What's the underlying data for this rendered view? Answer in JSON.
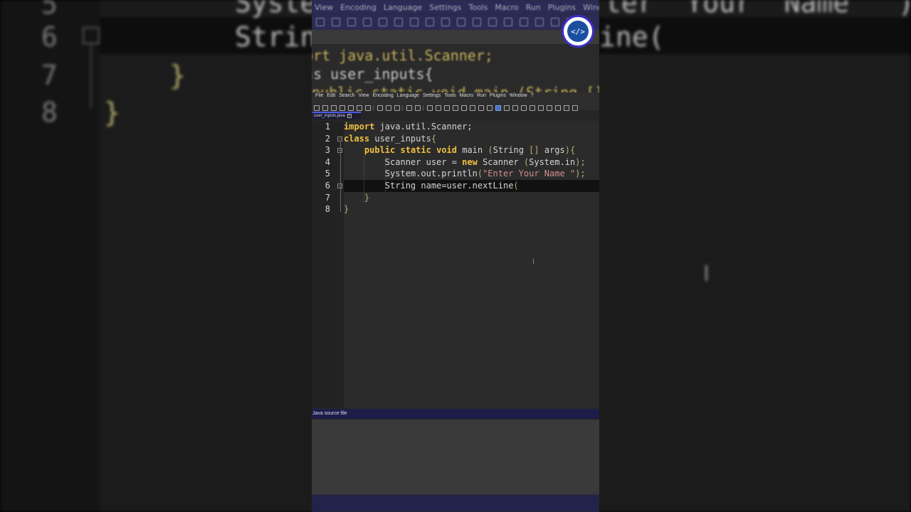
{
  "background": {
    "line_numbers": [
      "5",
      "6",
      "7",
      "8"
    ],
    "code_lines": [
      "Syste",
      "Strin",
      "ter  Your  Name  \");",
      "ine("
    ]
  },
  "zoom": {
    "menu": [
      "View",
      "Encoding",
      "Language",
      "Settings",
      "Tools",
      "Macro",
      "Run",
      "Plugins",
      "Window"
    ],
    "code_lines": [
      "ort java.util.Scanner;",
      "ss user_inputs{",
      "public static void main (String []"
    ]
  },
  "logo": {
    "label": "</>"
  },
  "menubar": {
    "items": [
      "File",
      "Edit",
      "Search",
      "View",
      "Encoding",
      "Language",
      "Settings",
      "Tools",
      "Macro",
      "Run",
      "Plugins",
      "Window",
      "?"
    ]
  },
  "tab": {
    "filename": "user_inputs.java",
    "close": "×"
  },
  "editor": {
    "line_numbers": [
      "1",
      "2",
      "3",
      "4",
      "5",
      "6",
      "7",
      "8"
    ],
    "lines": {
      "l1": {
        "kw": "import",
        "rest": " java.util.Scanner;"
      },
      "l2": {
        "kw": "class",
        "rest": " user_inputs",
        "brace": "{"
      },
      "l3": {
        "indent": "    ",
        "kw1": "public",
        "kw2": "static",
        "kw3": "void",
        "rest": " main ",
        "p1": "(",
        "rest2": "String ",
        "p2": "[]",
        "rest3": " args",
        "p3": "){"
      },
      "l4": {
        "indent": "        ",
        "rest": "Scanner user = ",
        "kw": "new",
        "rest2": " Scanner ",
        "p1": "(",
        "rest3": "System.in",
        "p2": ");"
      },
      "l5": {
        "indent": "        ",
        "rest": "System.out.println",
        "p1": "(",
        "str": "\"Enter Your Name \"",
        "p2": ");"
      },
      "l6": {
        "indent": "        ",
        "rest": "String name=user.nextLine",
        "p1": "("
      },
      "l7": {
        "indent": "    ",
        "brace": "}"
      },
      "l8": {
        "brace": "}"
      }
    }
  },
  "status": {
    "file_type": "Java source file"
  },
  "colors": {
    "keyword": "#f0c040",
    "string": "#d48c8c",
    "accent": "#4a5af0",
    "statusbar": "#1d1d4a"
  }
}
